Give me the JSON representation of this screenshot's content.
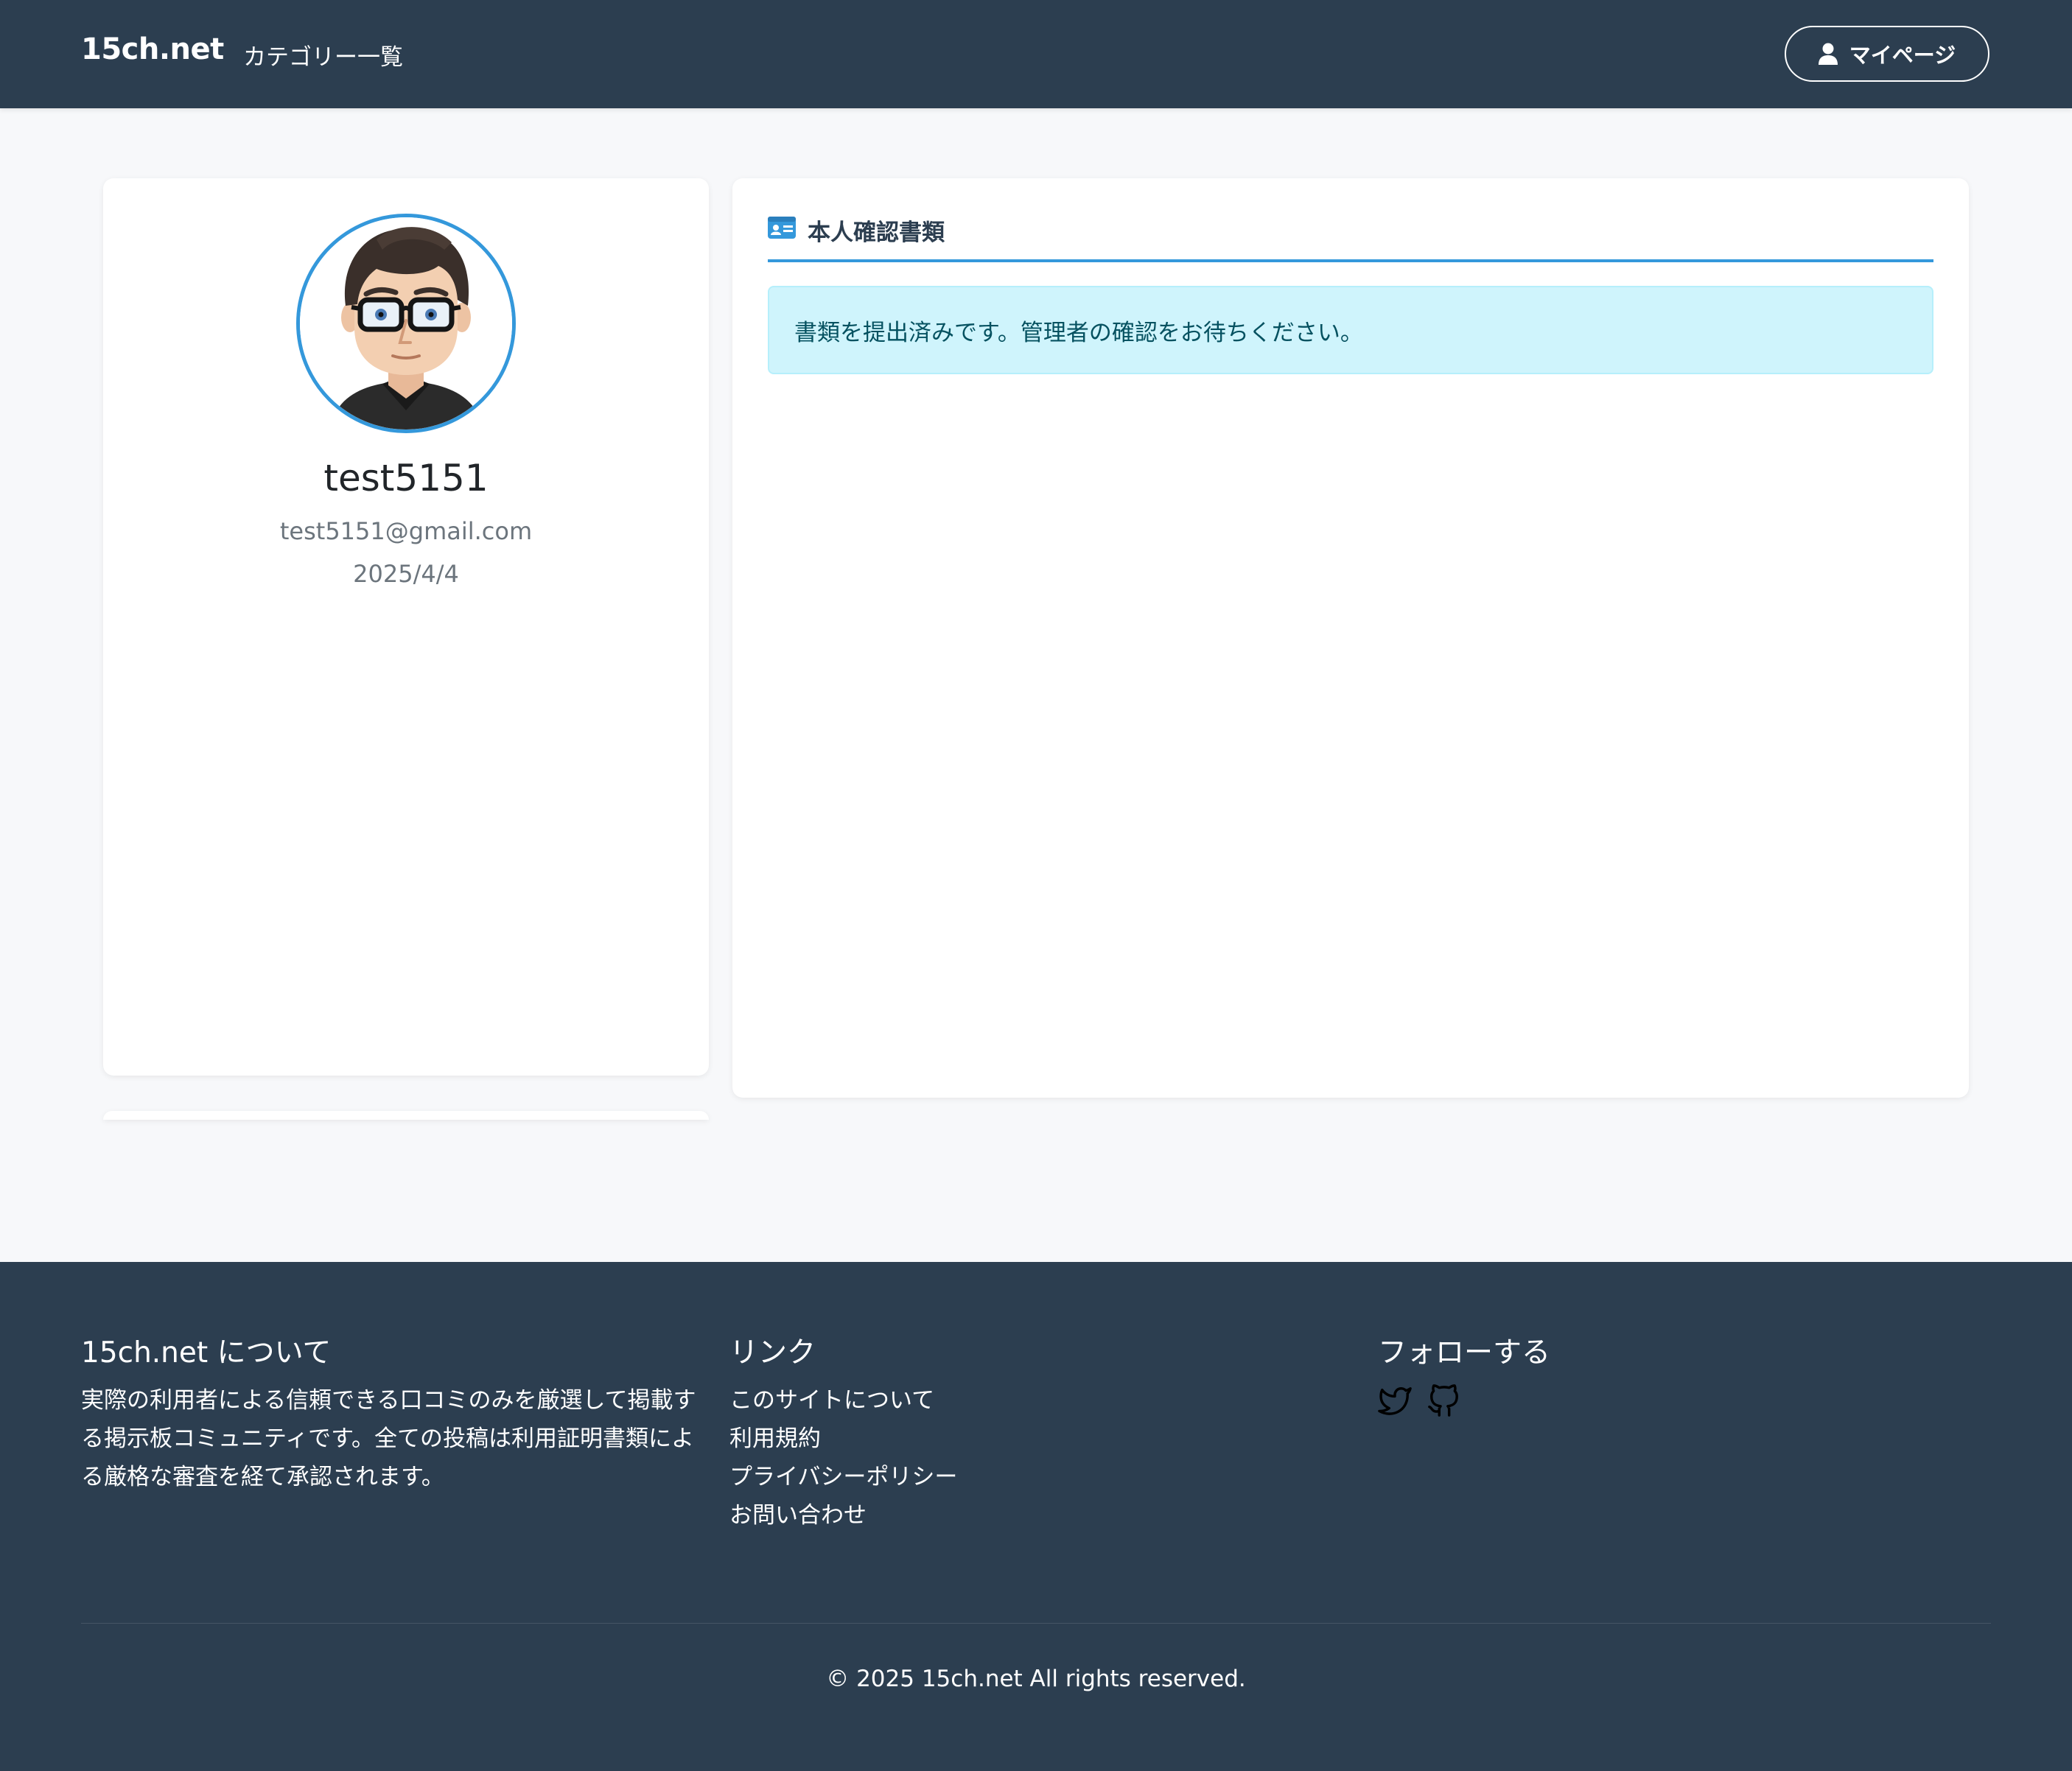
{
  "navbar": {
    "brand": "15ch.net",
    "categories_link": "カテゴリー一覧",
    "mypage_button": "マイページ",
    "mypage_icon": "user-icon"
  },
  "profile": {
    "username": "test5151",
    "email": "test5151@gmail.com",
    "date": "2025/4/4",
    "avatar": "cartoon-man-avatar"
  },
  "documents": {
    "title": "本人確認書類",
    "icon": "id-card-icon",
    "status_message": "書類を提出済みです。管理者の確認をお待ちください。"
  },
  "footer": {
    "about": {
      "title": "15ch.net について",
      "text": "実際の利用者による信頼できる口コミのみを厳選して掲載する掲示板コミュニティです。全ての投稿は利用証明書類による厳格な審査を経て承認されます。"
    },
    "links": {
      "title": "リンク",
      "items": [
        "このサイトについて",
        "利用規約",
        "プライバシーポリシー",
        "お問い合わせ"
      ]
    },
    "follow": {
      "title": "フォローする",
      "icons": [
        "twitter-icon",
        "github-icon"
      ]
    },
    "copyright": "© 2025 15ch.net All rights reserved."
  },
  "colors": {
    "navbar_bg": "#2c3e50",
    "accent": "#3498db",
    "page_bg": "#f7f8fa",
    "alert_bg": "#cff4fc",
    "alert_text": "#055160"
  }
}
